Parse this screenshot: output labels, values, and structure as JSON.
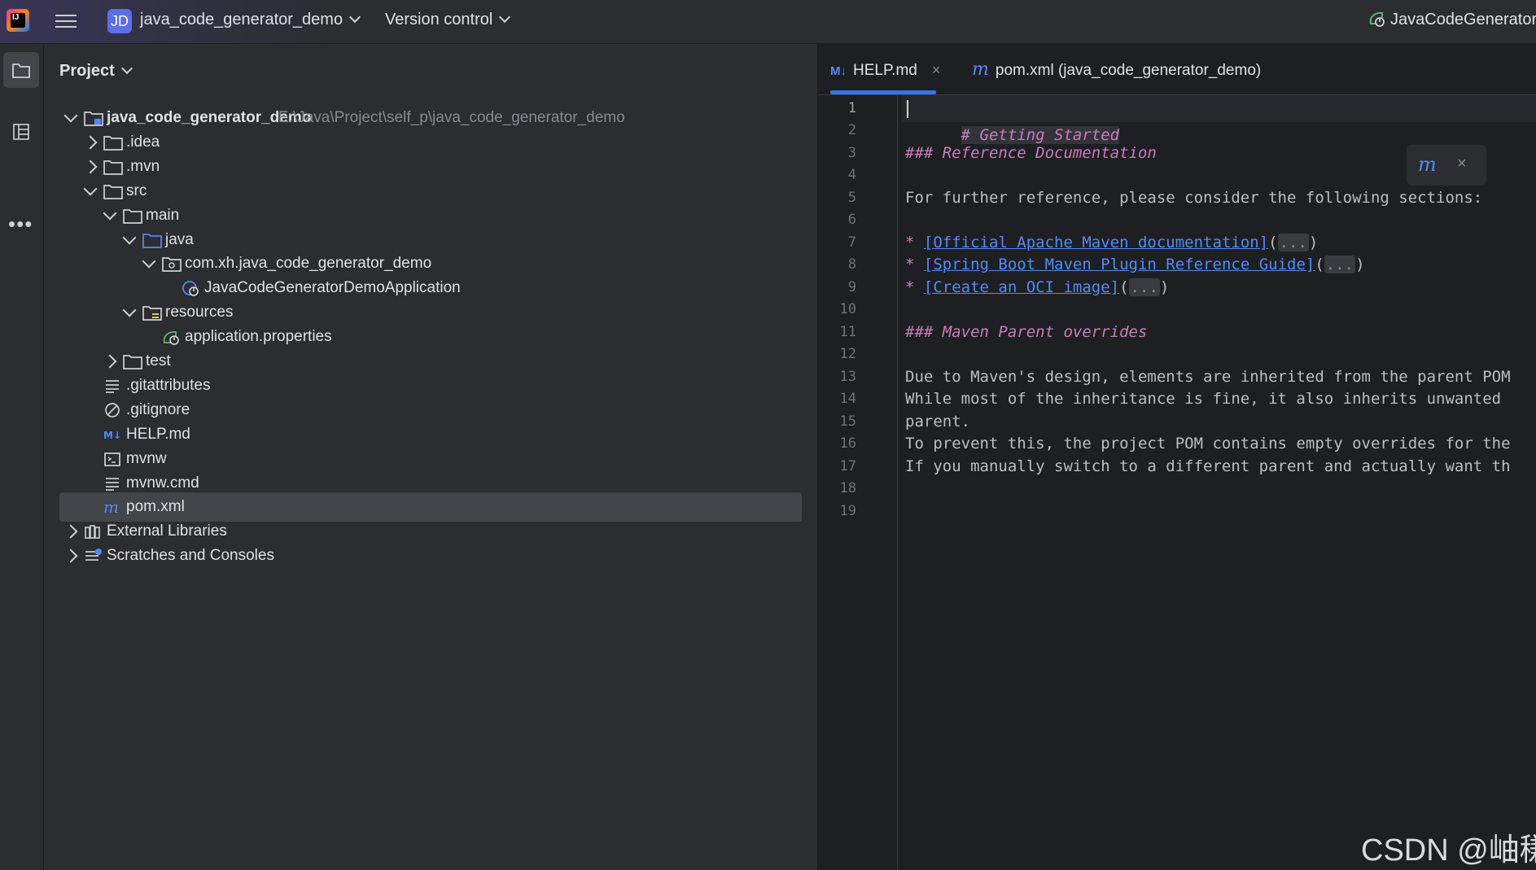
{
  "titlebar": {
    "project_badge": "JD",
    "project_name": "java_code_generator_demo",
    "vcs_label": "Version control",
    "run_config": "JavaCodeGeneratorD"
  },
  "project_panel": {
    "title": "Project",
    "tree": [
      {
        "label": "java_code_generator_demo",
        "path": "E:\\Java\\Project\\self_p\\java_code_generator_demo",
        "icon": "module-folder-icon"
      },
      {
        "label": ".idea",
        "icon": "folder-icon"
      },
      {
        "label": ".mvn",
        "icon": "folder-icon"
      },
      {
        "label": "src",
        "icon": "folder-icon"
      },
      {
        "label": "main",
        "icon": "folder-icon"
      },
      {
        "label": "java",
        "icon": "source-folder-icon"
      },
      {
        "label": "com.xh.java_code_generator_demo",
        "icon": "package-icon"
      },
      {
        "label": "JavaCodeGeneratorDemoApplication",
        "icon": "spring-boot-class-icon"
      },
      {
        "label": "resources",
        "icon": "resources-folder-icon"
      },
      {
        "label": "application.properties",
        "icon": "spring-properties-icon"
      },
      {
        "label": "test",
        "icon": "folder-icon"
      },
      {
        "label": ".gitattributes",
        "icon": "text-file-icon"
      },
      {
        "label": ".gitignore",
        "icon": "ignore-file-icon"
      },
      {
        "label": "HELP.md",
        "icon": "markdown-icon"
      },
      {
        "label": "mvnw",
        "icon": "shell-script-icon"
      },
      {
        "label": "mvnw.cmd",
        "icon": "text-file-icon"
      },
      {
        "label": "pom.xml",
        "icon": "maven-icon"
      },
      {
        "label": "External Libraries",
        "icon": "library-icon"
      },
      {
        "label": "Scratches and Consoles",
        "icon": "scratches-icon"
      }
    ]
  },
  "editor": {
    "tabs": [
      {
        "label": "HELP.md",
        "icon_text": "M↓",
        "close": "×"
      },
      {
        "label": "pom.xml (java_code_generator_demo)",
        "icon_text": "m"
      }
    ],
    "line_numbers": [
      "1",
      "2",
      "3",
      "4",
      "5",
      "6",
      "7",
      "8",
      "9",
      "10",
      "11",
      "12",
      "13",
      "14",
      "15",
      "16",
      "17",
      "18",
      "19"
    ],
    "lines": {
      "l1": "# Getting Started",
      "l3": "### Reference Documentation",
      "l5": "For further reference, please consider the following sections:",
      "l7_bullet": "* ",
      "l7_link": "[Official Apache Maven documentation]",
      "l7_open": "(",
      "l7_fold": "...",
      "l7_close": ")",
      "l8_bullet": "* ",
      "l8_link": "[Spring Boot Maven Plugin Reference Guide]",
      "l8_open": "(",
      "l8_fold": "...",
      "l8_close": ")",
      "l9_bullet": "* ",
      "l9_link": "[Create an OCI image]",
      "l9_open": "(",
      "l9_fold": "...",
      "l9_close": ")",
      "l11": "### Maven Parent overrides",
      "l13": "Due to Maven's design, elements are inherited from the parent POM",
      "l14": "While most of the inheritance is fine, it also inherits unwanted",
      "l15": "parent.",
      "l16": "To prevent this, the project POM contains empty overrides for the",
      "l17": "If you manually switch to a different parent and actually want th"
    },
    "floating_toolbar": {
      "icon_text": "m",
      "close": "×"
    }
  },
  "watermark": "CSDN @岫稴",
  "colors": {
    "accent": "#3574f0",
    "heading": "#c77dbb",
    "link": "#548af7",
    "background": "#1e1f22",
    "panel": "#2b2d30"
  }
}
